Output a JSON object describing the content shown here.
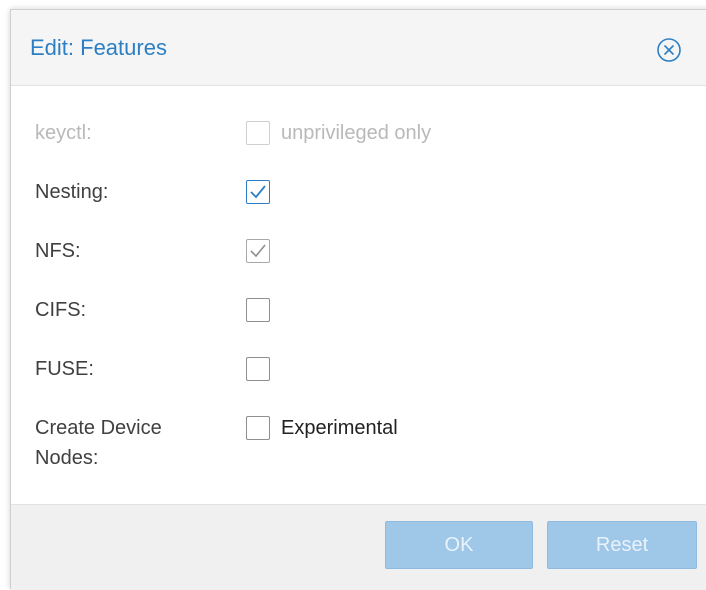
{
  "dialog": {
    "title": "Edit: Features"
  },
  "fields": [
    {
      "label": "keyctl:",
      "checked": false,
      "disabled": true,
      "box_label": "unprivileged only"
    },
    {
      "label": "Nesting:",
      "checked": true,
      "disabled": false
    },
    {
      "label": "NFS:",
      "checked": true,
      "disabled": false
    },
    {
      "label": "CIFS:",
      "checked": false,
      "disabled": false
    },
    {
      "label": "FUSE:",
      "checked": false,
      "disabled": false
    },
    {
      "label_line1": "Create Device",
      "label_line2": "Nodes:",
      "checked": false,
      "disabled": false,
      "box_label": "Experimental"
    }
  ],
  "buttons": {
    "ok_label": "OK",
    "reset_label": "Reset"
  },
  "icons": {
    "close": "close-circle-x-icon",
    "check": "checkmark-icon"
  },
  "colors": {
    "accent": "#2c7fc4",
    "button_disabled": "#9ec7e8",
    "text": "#404040",
    "text_disabled": "#b9b9b9"
  }
}
